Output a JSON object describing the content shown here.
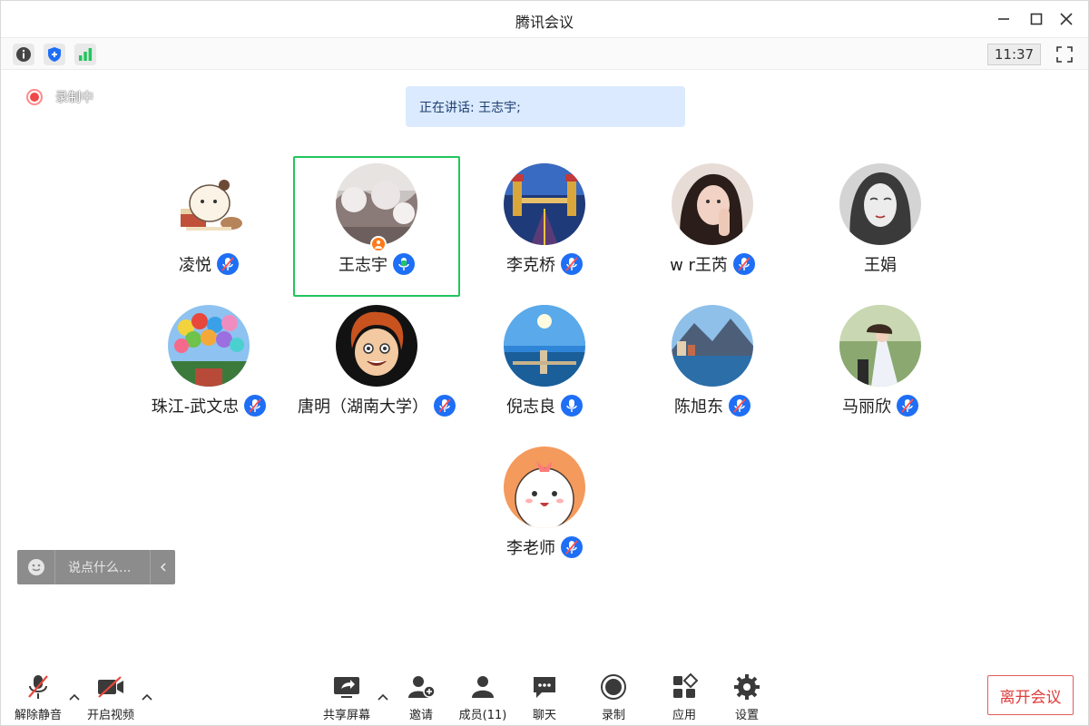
{
  "window": {
    "title": "腾讯会议"
  },
  "toolbar": {
    "clock": "11:37"
  },
  "recording": {
    "label": "录制中"
  },
  "speaking": {
    "text": "正在讲话: 王志宇;"
  },
  "participants": [
    {
      "name": "凌悦",
      "mic": "muted"
    },
    {
      "name": "王志宇",
      "mic": "speaking",
      "host": true
    },
    {
      "name": "李克桥",
      "mic": "muted"
    },
    {
      "name": "w r王芮",
      "mic": "muted"
    },
    {
      "name": "王娟",
      "mic": "none"
    },
    {
      "name": "珠江-武文忠",
      "mic": "muted"
    },
    {
      "name": "唐明（湖南大学）",
      "mic": "muted"
    },
    {
      "name": "倪志良",
      "mic": "on"
    },
    {
      "name": "陈旭东",
      "mic": "muted"
    },
    {
      "name": "马丽欣",
      "mic": "muted"
    },
    {
      "name": "李老师",
      "mic": "muted"
    }
  ],
  "chat": {
    "placeholder": "说点什么..."
  },
  "bottom": {
    "unmute": "解除静音",
    "video": "开启视频",
    "share": "共享屏幕",
    "invite": "邀请",
    "members": "成员(11)",
    "chat": "聊天",
    "record": "录制",
    "apps": "应用",
    "settings": "设置",
    "leave": "离开会议"
  },
  "colors": {
    "accent": "#1e6ff5",
    "active_border": "#22c55e",
    "leave": "#e03c3c",
    "banner": "#dbeafe"
  }
}
